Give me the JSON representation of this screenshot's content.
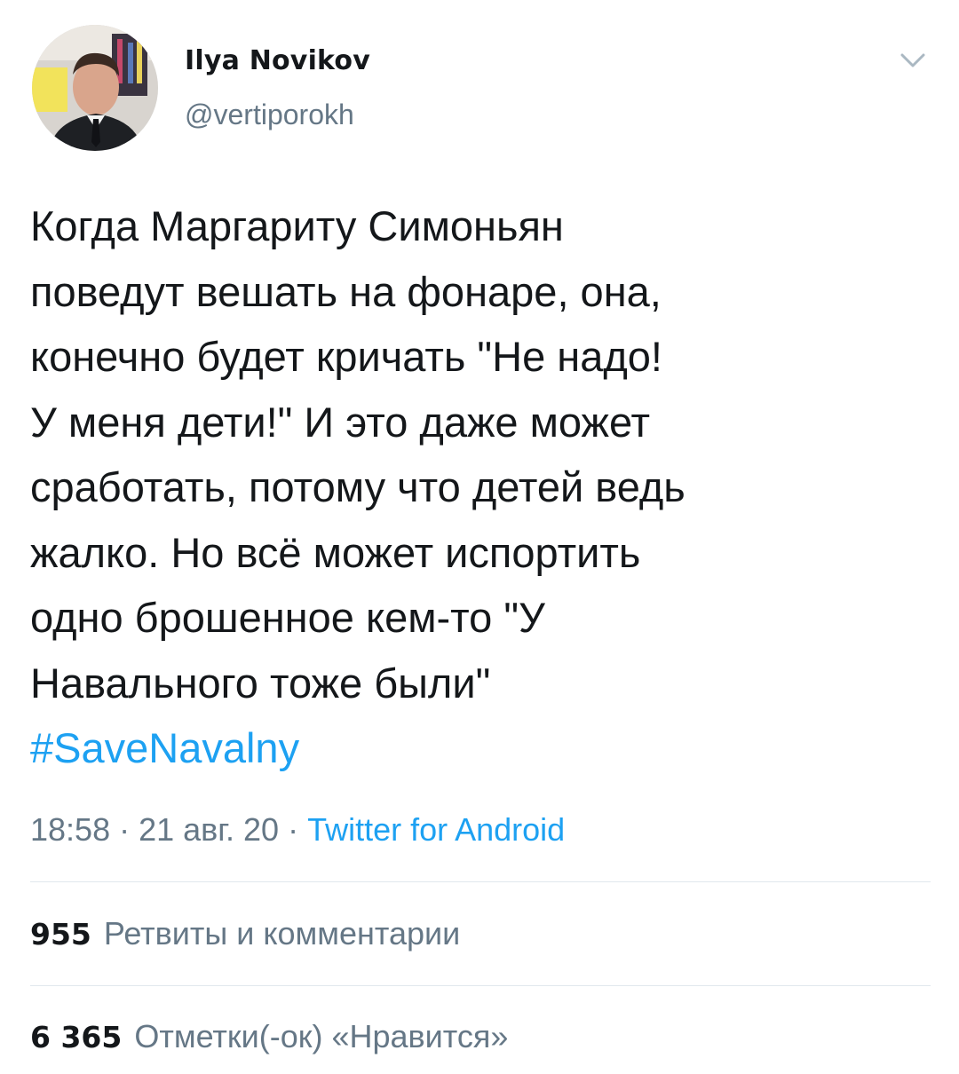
{
  "author": {
    "display_name": "Ilya Novikov",
    "handle": "@vertiporokh"
  },
  "icons": {
    "avatar": "profile-photo",
    "menu": "chevron-down-icon"
  },
  "tweet": {
    "lines": [
      "Когда Маргариту Симоньян",
      "поведут вешать на фонаре, она,",
      "конечно будет кричать \"Не надо!",
      "У меня дети!\" И это даже может",
      "сработать, потому что детей ведь",
      "жалко. Но всё может испортить",
      "одно брошенное кем-то \"У",
      "Навального тоже были\""
    ],
    "hashtag": "#SaveNavalny"
  },
  "meta": {
    "time": "18:58",
    "separator1": " · ",
    "date": "21 авг. 20",
    "separator2": " · ",
    "source": "Twitter for Android"
  },
  "stats": {
    "retweets_count": "955",
    "retweets_label": "Ретвиты и комментарии",
    "likes_count": "6 365",
    "likes_label": "Отметки(-ок) «Нравится»"
  },
  "colors": {
    "link": "#1da1f2",
    "secondary_text": "#657786",
    "primary_text": "#14171a",
    "divider": "#e1e8ed"
  }
}
